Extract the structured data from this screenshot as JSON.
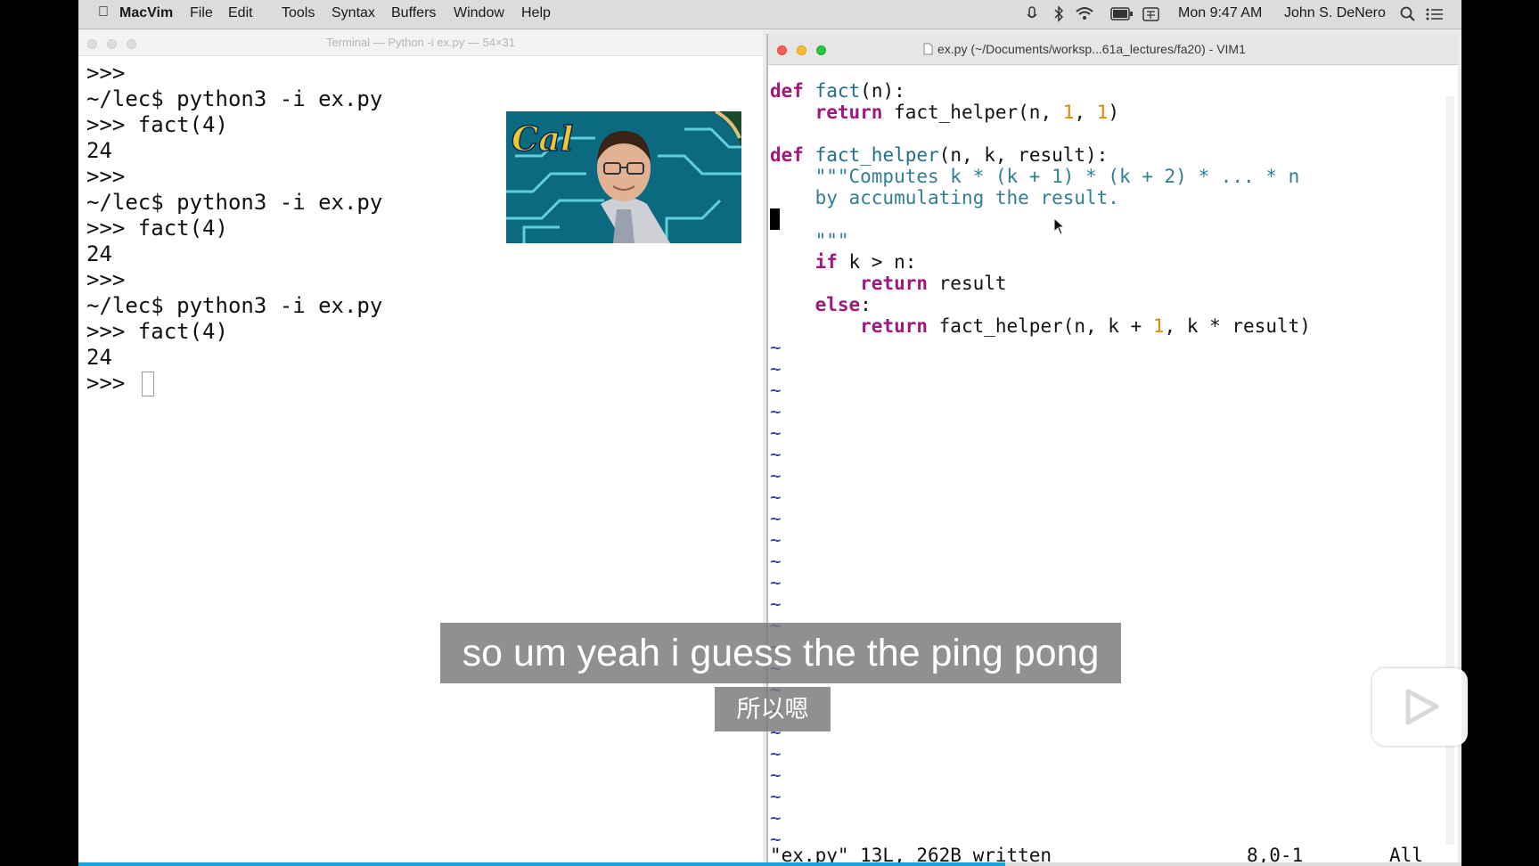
{
  "menubar": {
    "app_name": "MacVim",
    "items": [
      "File",
      "Edit",
      "Tools",
      "Syntax",
      "Buffers",
      "Window",
      "Help"
    ],
    "clock": "Mon 9:47 AM",
    "user": "John S. DeNero"
  },
  "terminal": {
    "title": "Terminal — Python -i ex.py — 54×31",
    "lines": [
      ">>>",
      "~/lec$ python3 -i ex.py",
      ">>> fact(4)",
      "24",
      ">>>",
      "~/lec$ python3 -i ex.py",
      ">>> fact(4)",
      "24",
      ">>>",
      "~/lec$ python3 -i ex.py",
      ">>> fact(4)",
      "24"
    ],
    "prompt": ">>>"
  },
  "vim": {
    "title": "ex.py (~/Documents/worksp...61a_lectures/fa20) - VIM1",
    "code": {
      "l1_def": "def",
      "l1_fn": "fact",
      "l1_rest": "(n):",
      "l2_ret": "return",
      "l2_a": " fact_helper(n, ",
      "l2_n1": "1",
      "l2_b": ", ",
      "l2_n2": "1",
      "l2_c": ")",
      "l4_def": "def",
      "l4_fn": "fact_helper",
      "l4_rest": "(n, k, result):",
      "l5_doc": "\"\"\"Computes k * (k + 1) * (k + 2) * ... * n",
      "l6_doc": "by accumulating the result.",
      "l8_doc": "\"\"\"",
      "l9_if": "if",
      "l9_rest": " k > n:",
      "l10_ret": "return",
      "l10_rest": " result",
      "l11_else": "else",
      "l11_rest": ":",
      "l12_ret": "return",
      "l12_a": " fact_helper(n, k + ",
      "l12_n": "1",
      "l12_b": ", k * result)"
    },
    "tilde": "~",
    "status_message": "\"ex.py\" 13L, 262B written",
    "cursor_pos": "8,0-1",
    "scroll_pos": "All"
  },
  "subtitles": {
    "english": "so um yeah i guess the the ping pong",
    "chinese": "所以嗯"
  },
  "video": {
    "progress": 0.67
  }
}
